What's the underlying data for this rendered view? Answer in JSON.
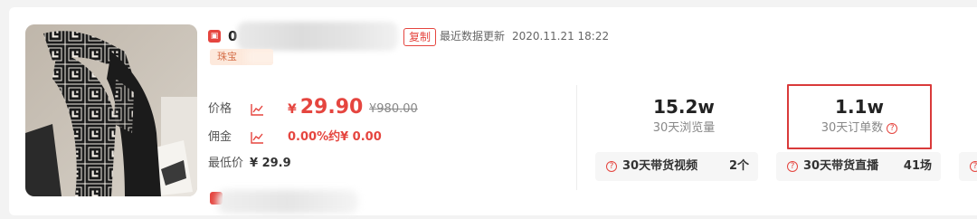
{
  "product": {
    "shop_icon": "shop-bag-icon",
    "title_visible_prefix": "0",
    "copy_label": "复制",
    "update_label": "最近数据更新",
    "update_time": "2020.11.21 18:22",
    "tag_text": "珠宝"
  },
  "pricing": {
    "price_label": "价格",
    "price_currency": "¥",
    "price_value": "29.90",
    "original_price": "¥980.00",
    "commission_label": "佣金",
    "commission_value": "0.00%约¥ 0.00",
    "lowest_label": "最低价",
    "lowest_value": "¥ 29.9"
  },
  "stats": [
    {
      "value": "15.2w",
      "label": "30天浏览量"
    },
    {
      "value": "1.1w",
      "label": "30天订单数"
    }
  ],
  "pills": [
    {
      "label": "30天带货视频",
      "value": "2个"
    },
    {
      "label": "30天带货直播",
      "value": "41场"
    }
  ],
  "colors": {
    "accent": "#e5453f",
    "highlight_border": "#d93a3a",
    "tag_bg": "#fde9dc"
  }
}
